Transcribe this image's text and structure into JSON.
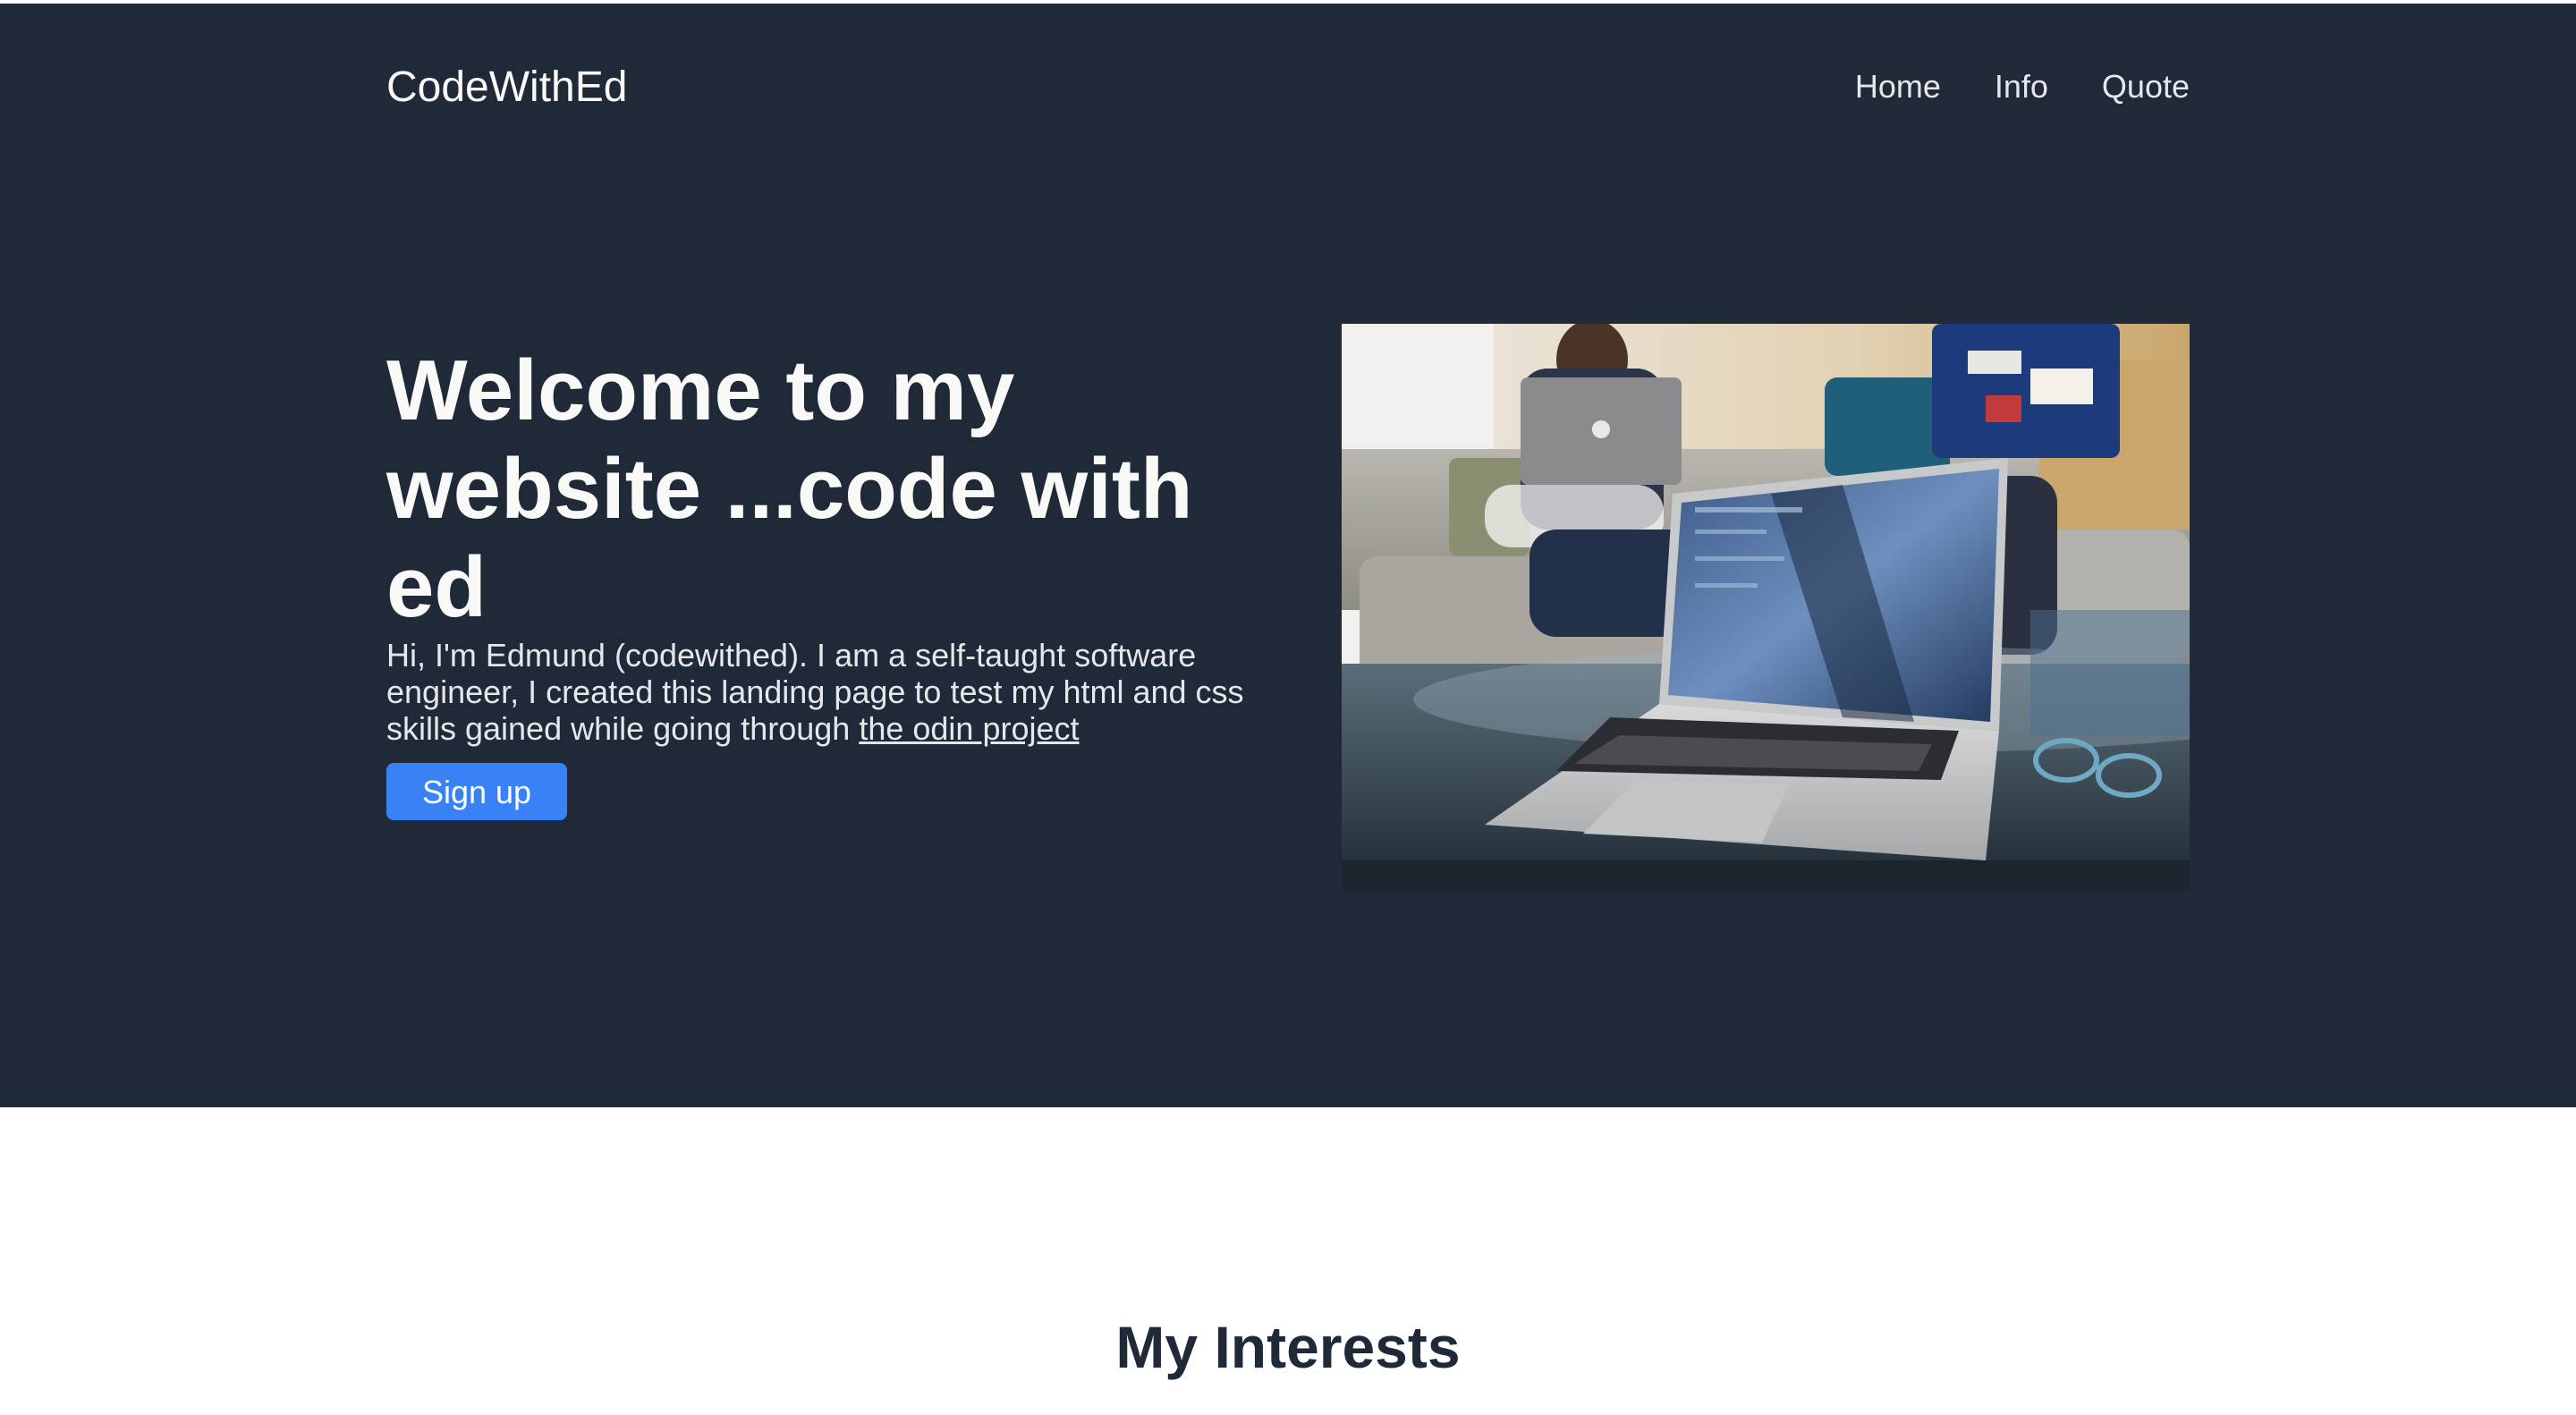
{
  "header": {
    "logo": "CodeWithEd",
    "nav": [
      {
        "label": "Home"
      },
      {
        "label": "Info"
      },
      {
        "label": "Quote"
      }
    ]
  },
  "hero": {
    "title": "Welcome to my website ...code with ed",
    "description_prefix": "Hi, I'm Edmund (codewithed). I am a self-taught software engineer, I created this landing page to test my html and css skills gained while going through ",
    "link_text": "the odin project",
    "signup_label": "Sign up",
    "image": "laptop-on-glass-table-photo"
  },
  "interests": {
    "title": "My Interests"
  },
  "colors": {
    "hero_background": "#1f2937",
    "accent": "#3882f6",
    "text_light": "#f9faf8"
  }
}
